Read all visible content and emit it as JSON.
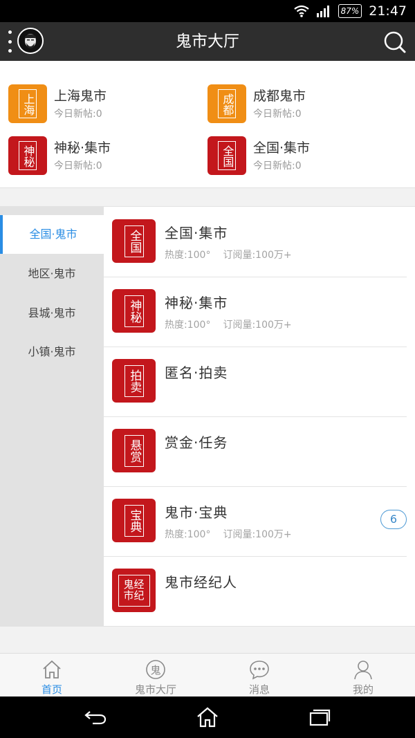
{
  "status": {
    "battery": "87%",
    "time": "21:47"
  },
  "header": {
    "title": "鬼市大厅"
  },
  "quick_tiles": [
    {
      "name": "上海鬼市",
      "seal": "上海",
      "sub": "今日新帖:0",
      "color": "#f08e15"
    },
    {
      "name": "成都鬼市",
      "seal": "成都",
      "sub": "今日新帖:0",
      "color": "#f08e15"
    },
    {
      "name": "神秘·集市",
      "seal": "神秘",
      "sub": "今日新帖:0",
      "color": "#c3171c"
    },
    {
      "name": "全国·集市",
      "seal": "全国",
      "sub": "今日新帖:0",
      "color": "#c3171c"
    }
  ],
  "left_nav": [
    "全国·鬼市",
    "地区·鬼市",
    "县城·鬼市",
    "小镇·鬼市"
  ],
  "rows": [
    {
      "title": "全国·集市",
      "seal": "全国",
      "heat": "热度:100°",
      "subs": "订阅量:100万+",
      "badge": ""
    },
    {
      "title": "神秘·集市",
      "seal": "神秘",
      "heat": "热度:100°",
      "subs": "订阅量:100万+",
      "badge": ""
    },
    {
      "title": "匿名·拍卖",
      "seal": "拍卖",
      "heat": "",
      "subs": "",
      "badge": ""
    },
    {
      "title": "赏金·任务",
      "seal": "悬赏",
      "heat": "",
      "subs": "",
      "badge": ""
    },
    {
      "title": "鬼市·宝典",
      "seal": "宝典",
      "heat": "热度:100°",
      "subs": "订阅量:100万+",
      "badge": "6"
    },
    {
      "title": "鬼市经纪人",
      "seal": "鬼经市纪",
      "heat": "",
      "subs": "",
      "badge": ""
    }
  ],
  "tabs": [
    "首页",
    "鬼市大厅",
    "消息",
    "我的"
  ],
  "tab_ghost_glyph": "鬼",
  "colors": {
    "accent": "#2a8de4",
    "seal_red": "#c3171c",
    "seal_orange": "#f08e15"
  }
}
